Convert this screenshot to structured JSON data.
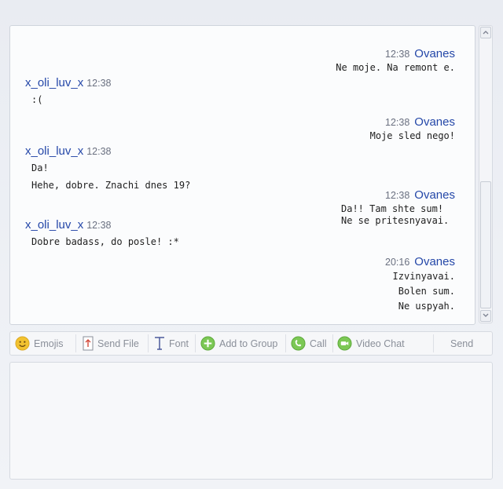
{
  "conversation": {
    "messages": [
      {
        "sender": "Ovanes",
        "time": "12:38",
        "side": "right",
        "lines": [
          "Ne moje. Na remont e."
        ]
      },
      {
        "sender": "x_oli_luv_x",
        "time": "12:38",
        "side": "left",
        "lines": [
          ":("
        ]
      },
      {
        "sender": "Ovanes",
        "time": "12:38",
        "side": "right",
        "lines": [
          "Moje sled nego!"
        ]
      },
      {
        "sender": "x_oli_luv_x",
        "time": "12:38",
        "side": "left",
        "lines": [
          "Da!",
          "Hehe, dobre. Znachi dnes 19?"
        ]
      },
      {
        "sender": "Ovanes",
        "time": "12:38",
        "side": "right",
        "lines": [
          "Da!! Tam shte sum!",
          "Ne se pritesnyavai."
        ]
      },
      {
        "sender": "x_oli_luv_x",
        "time": "12:38",
        "side": "left",
        "lines": [
          "Dobre badass, do posle! :*"
        ]
      },
      {
        "sender": "Ovanes",
        "time": "20:16",
        "side": "right",
        "lines": [
          "Izvinyavai.",
          "Bolen sum.",
          "Ne uspyah."
        ]
      }
    ]
  },
  "toolbar": {
    "emojis": "Emojis",
    "send_file": "Send File",
    "font": "Font",
    "add_to_group": "Add to Group",
    "call": "Call",
    "video_chat": "Video Chat",
    "send": "Send"
  },
  "colors": {
    "sender_name": "#2447a8",
    "emoji_yellow": "#f2c230",
    "green_button": "#7cc855"
  },
  "icons": {
    "emojis": "smiley-icon",
    "send_file": "file-upload-icon",
    "font": "font-icon",
    "add_to_group": "plus-circle-icon",
    "call": "phone-icon",
    "video_chat": "video-icon"
  },
  "input": {
    "value": ""
  }
}
